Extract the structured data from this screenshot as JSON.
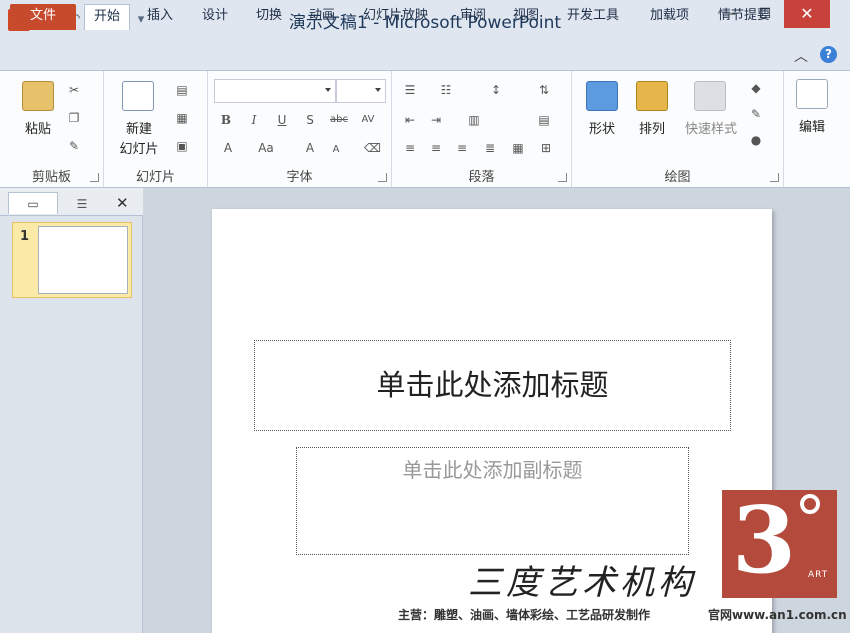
{
  "app": {
    "logo_letter": "P",
    "title": "演示文稿1 - Microsoft PowerPoint"
  },
  "qat": {
    "save": "💾",
    "undo": "↶",
    "redo": "↻",
    "customize": "▾"
  },
  "window": {
    "minimize": "—",
    "maximize": "☐",
    "close": "✕"
  },
  "tabs": [
    "文件",
    "开始",
    "插入",
    "设计",
    "切换",
    "动画",
    "幻灯片放映",
    "审阅",
    "视图",
    "开发工具",
    "加载项",
    "情节提要"
  ],
  "ribbon_right": {
    "collapse": "︿",
    "help": "?"
  },
  "groups": {
    "clipboard": {
      "label": "剪贴板",
      "paste": "粘贴"
    },
    "slides": {
      "label": "幻灯片",
      "new_slide_1": "新建",
      "new_slide_2": "幻灯片"
    },
    "font": {
      "label": "字体"
    },
    "paragraph": {
      "label": "段落"
    },
    "drawing": {
      "label": "绘图",
      "shapes": "形状",
      "arrange": "排列",
      "quick_styles": "快速样式"
    },
    "editing": {
      "label": "编辑"
    }
  },
  "font_buttons": {
    "bold": "B",
    "italic": "I",
    "underline": "U",
    "shadow": "S",
    "strike": "abc",
    "spacing": "AV",
    "grow": "A",
    "size_case": "Aa",
    "grow2": "A",
    "shrink": "A"
  },
  "panel": {
    "close": "✕",
    "slide_number": "1"
  },
  "slide": {
    "title_placeholder": "单击此处添加标题",
    "subtitle_placeholder": "单击此处添加副标题"
  },
  "watermark": {
    "logo_digit": "3",
    "logo_art": "ART",
    "name": "三度艺术机构",
    "tagline": "主营：雕塑、油画、墙体彩绘、工艺品研发制作",
    "site": "官网www.an1.com.cn"
  }
}
